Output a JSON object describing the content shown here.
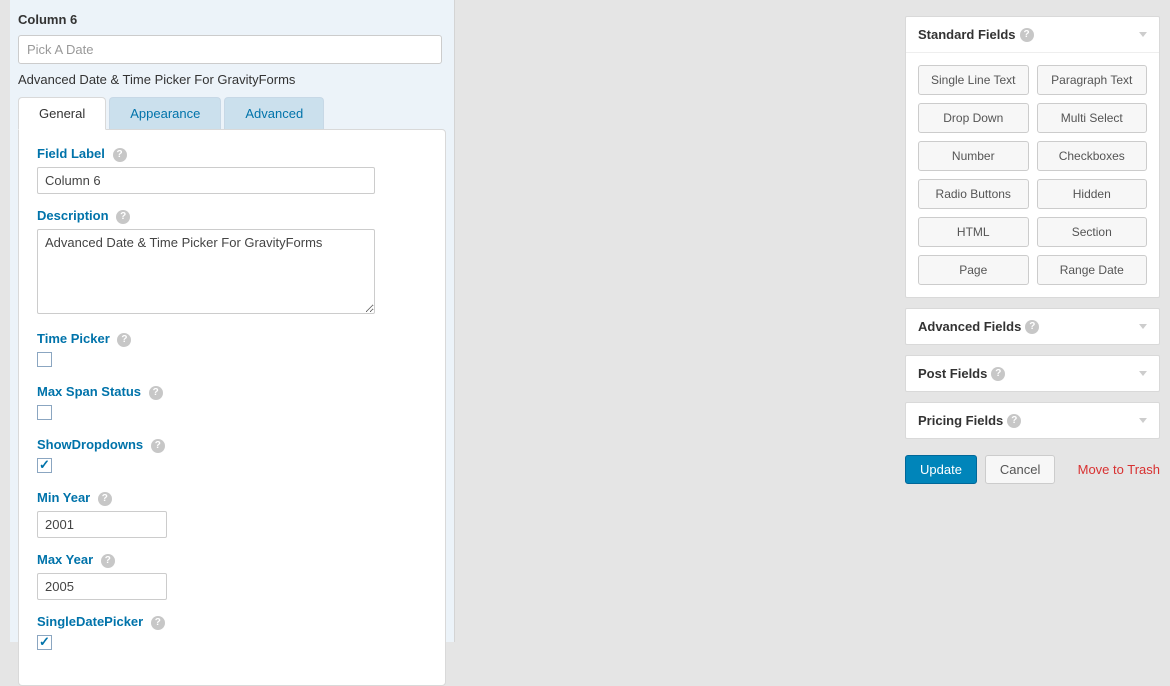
{
  "field": {
    "title": "Column 6",
    "placeholder": "Pick A Date",
    "subtitle": "Advanced Date & Time Picker For GravityForms"
  },
  "tabs": {
    "general": "General",
    "appearance": "Appearance",
    "advanced": "Advanced"
  },
  "settings": {
    "fieldLabel": {
      "label": "Field Label",
      "value": "Column 6"
    },
    "description": {
      "label": "Description",
      "value": "Advanced Date & Time Picker For GravityForms"
    },
    "timePicker": {
      "label": "Time Picker",
      "checked": false
    },
    "maxSpan": {
      "label": "Max Span Status",
      "checked": false
    },
    "showDropdowns": {
      "label": "ShowDropdowns",
      "checked": true
    },
    "minYear": {
      "label": "Min Year",
      "value": "2001"
    },
    "maxYear": {
      "label": "Max Year",
      "value": "2005"
    },
    "singleDate": {
      "label": "SingleDatePicker",
      "checked": true
    }
  },
  "sidebar": {
    "standard": {
      "title": "Standard Fields",
      "items": [
        "Single Line Text",
        "Paragraph Text",
        "Drop Down",
        "Multi Select",
        "Number",
        "Checkboxes",
        "Radio Buttons",
        "Hidden",
        "HTML",
        "Section",
        "Page",
        "Range Date"
      ]
    },
    "advanced": {
      "title": "Advanced Fields"
    },
    "post": {
      "title": "Post Fields"
    },
    "pricing": {
      "title": "Pricing Fields"
    }
  },
  "actions": {
    "update": "Update",
    "cancel": "Cancel",
    "trash": "Move to Trash"
  }
}
